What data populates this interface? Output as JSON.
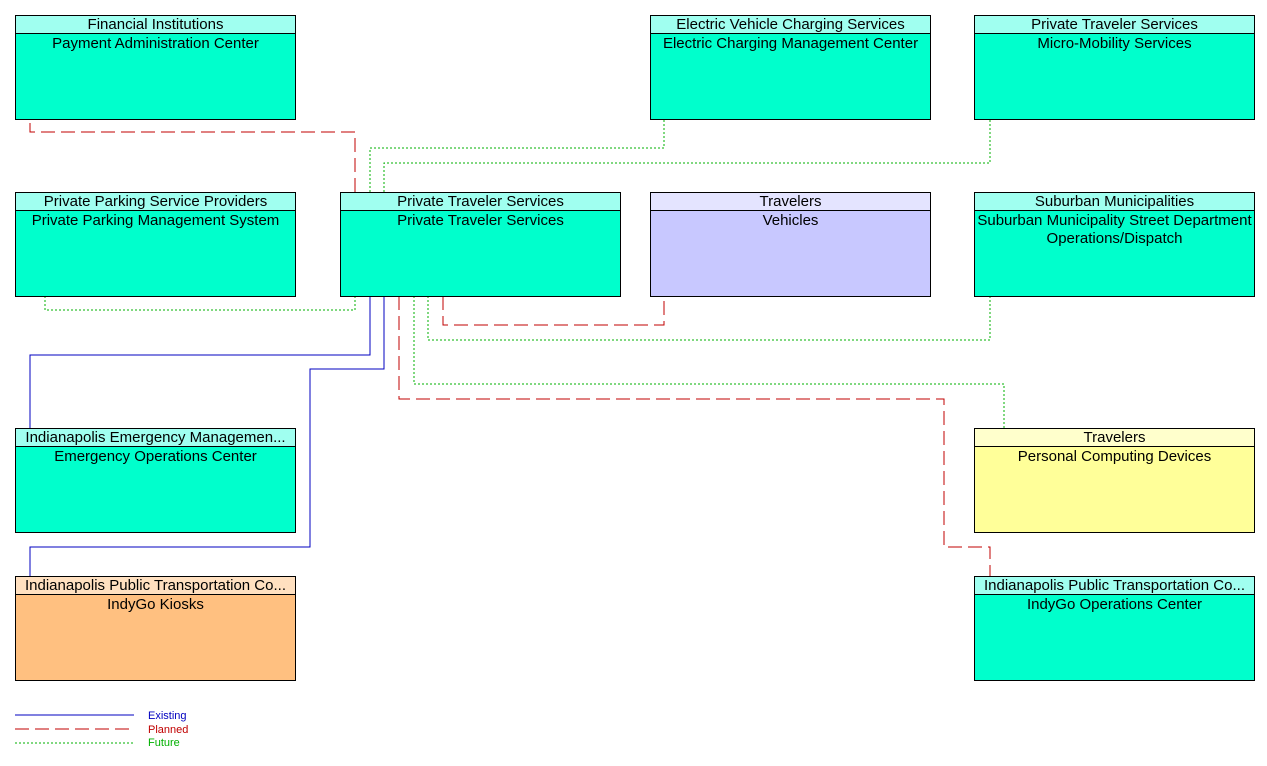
{
  "colors": {
    "existing": "#0000c0",
    "planned": "#c00000",
    "future": "#00b000",
    "center": "#00ffcc",
    "center_header": "#a0fff0",
    "vehicle": "#c8c8ff",
    "vehicle_header": "#e4e4ff",
    "personal": "#ffff99",
    "personal_header": "#ffffcc",
    "field": "#ffc080",
    "field_header": "#ffe0c0"
  },
  "boxes": [
    {
      "id": "pac",
      "header": "Financial Institutions",
      "name": "Payment Administration Center",
      "kind": "center"
    },
    {
      "id": "ecmc",
      "header": "Electric Vehicle Charging Services",
      "name": "Electric Charging Management Center",
      "kind": "center"
    },
    {
      "id": "mms",
      "header": "Private Traveler Services",
      "name": "Micro-Mobility Services",
      "kind": "center"
    },
    {
      "id": "ppms",
      "header": "Private Parking Service Providers",
      "name": "Private Parking Management System",
      "kind": "center"
    },
    {
      "id": "pts",
      "header": "Private Traveler Services",
      "name": "Private Traveler Services",
      "kind": "center"
    },
    {
      "id": "veh",
      "header": "Travelers",
      "name": "Vehicles",
      "kind": "vehicle"
    },
    {
      "id": "sub",
      "header": "Suburban Municipalities",
      "name": "Suburban Municipality Street Department Operations/Dispatch",
      "kind": "center"
    },
    {
      "id": "eoc",
      "header": "Indianapolis Emergency Managemen...",
      "name": "Emergency Operations Center",
      "kind": "center"
    },
    {
      "id": "pcd",
      "header": "Travelers",
      "name": "Personal Computing Devices",
      "kind": "personal"
    },
    {
      "id": "kiosk",
      "header": "Indianapolis Public Transportation Co...",
      "name": "IndyGo Kiosks",
      "kind": "field"
    },
    {
      "id": "ioc",
      "header": "Indianapolis Public Transportation Co...",
      "name": "IndyGo Operations Center",
      "kind": "center"
    }
  ],
  "flows": [
    {
      "from": "pts",
      "to": "pac",
      "status": "planned"
    },
    {
      "from": "pts",
      "to": "ecmc",
      "status": "future"
    },
    {
      "from": "pts",
      "to": "mms",
      "status": "future"
    },
    {
      "from": "pts",
      "to": "ppms",
      "status": "future"
    },
    {
      "from": "pts",
      "to": "eoc",
      "status": "existing"
    },
    {
      "from": "pts",
      "to": "kiosk",
      "status": "existing"
    },
    {
      "from": "pts",
      "to": "ioc",
      "status": "planned"
    },
    {
      "from": "pts",
      "to": "pcd",
      "status": "future"
    },
    {
      "from": "pts",
      "to": "sub",
      "status": "future"
    },
    {
      "from": "pts",
      "to": "veh",
      "status": "planned"
    }
  ],
  "legend": {
    "existing": "Existing",
    "planned": "Planned",
    "future": "Future"
  }
}
